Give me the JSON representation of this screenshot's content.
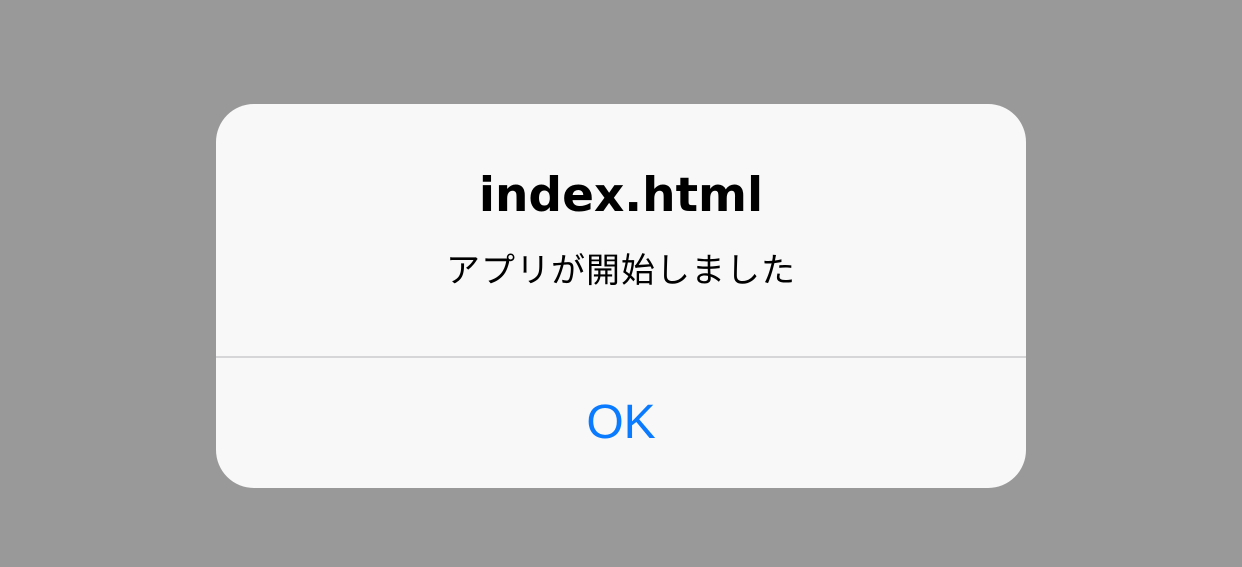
{
  "alert": {
    "title": "index.html",
    "message": "アプリが開始しました",
    "ok_label": "OK"
  },
  "colors": {
    "backdrop": "#999999",
    "dialog_background": "#f8f8f8",
    "divider": "#d6d6d8",
    "button_text": "#0a7aff",
    "text": "#000000"
  }
}
